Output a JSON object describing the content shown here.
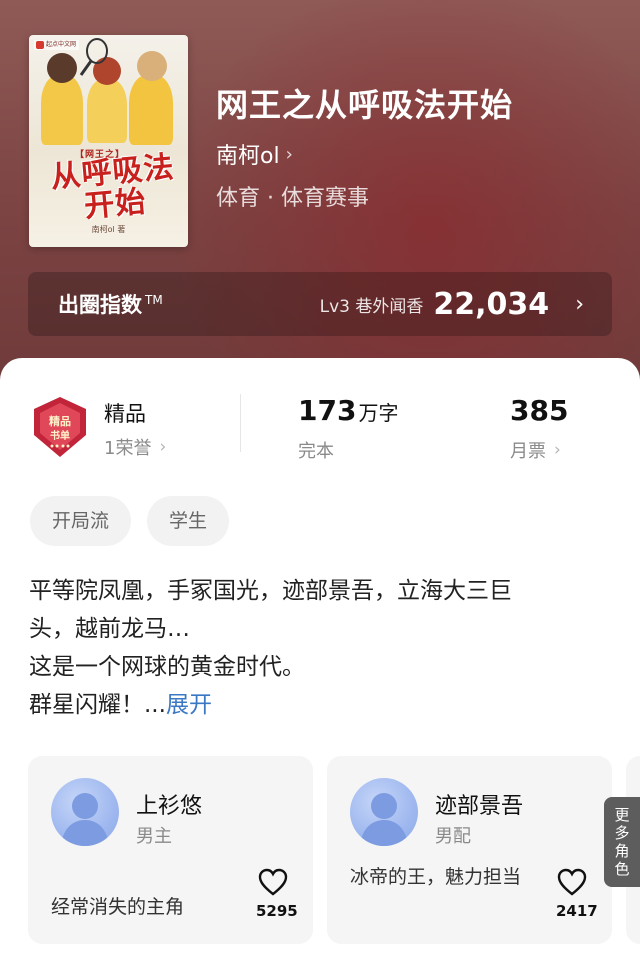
{
  "book": {
    "cover": {
      "badge": "起点中文网",
      "subtitle": "【网王之】",
      "title": "从呼吸法开始",
      "author": "南柯ol 著"
    },
    "title": "网王之从呼吸法开始",
    "author": "南柯ol",
    "category": "体育 · 体育赛事"
  },
  "index": {
    "label": "出圈指数",
    "trademark": "TM",
    "level": "Lv3 巷外闻香",
    "value": "22,034"
  },
  "stats": {
    "quality": {
      "title": "精品",
      "honor": "1荣誉",
      "medal_text": "精品书单"
    },
    "words": {
      "value": "173",
      "unit": "万字",
      "status": "完本"
    },
    "monthly": {
      "value": "385",
      "label": "月票"
    }
  },
  "tags": [
    "开局流",
    "学生"
  ],
  "description": {
    "line1": "平等院凤凰，手冢国光，迹部景吾，立海大三巨",
    "line2": "头，越前龙马…",
    "line3": "这是一个网球的黄金时代。",
    "line4": "群星闪耀！",
    "ellipsis": "...",
    "expand": "展开"
  },
  "characters": [
    {
      "name": "上衫悠",
      "role": "男主",
      "desc": "经常消失的主角",
      "likes": "5295"
    },
    {
      "name": "迹部景吾",
      "role": "男配",
      "desc": "冰帝的王，魅力担当",
      "likes": "2417"
    }
  ],
  "more_roles": "更多角色",
  "colors": {
    "header": "#7b4342",
    "link": "#3b78c4",
    "avatar": "#9fb8ef",
    "medal": "#c2243a"
  }
}
